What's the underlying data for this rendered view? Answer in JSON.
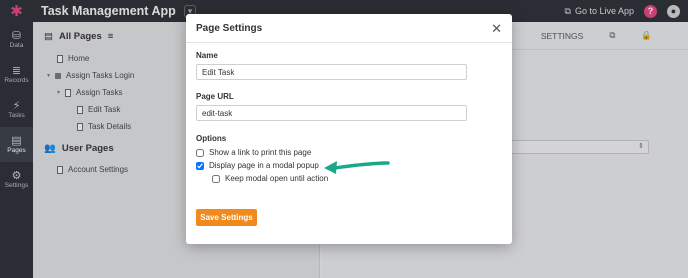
{
  "app": {
    "title": "Task Management App",
    "go_live": "Go to Live App"
  },
  "rail": [
    {
      "label": "Data",
      "icon": "database-icon",
      "glyph": "⛁"
    },
    {
      "label": "Records",
      "icon": "records-icon",
      "glyph": "≡"
    },
    {
      "label": "Tasks",
      "icon": "tasks-icon",
      "glyph": "⚡"
    },
    {
      "label": "Pages",
      "icon": "pages-icon",
      "glyph": "▤"
    },
    {
      "label": "Settings",
      "icon": "gear-icon",
      "glyph": "⚙"
    }
  ],
  "sidebar": {
    "all_pages": "All Pages",
    "tree": [
      {
        "label": "Home",
        "indent": 24,
        "kind": "doc"
      },
      {
        "label": "Assign Tasks Login",
        "indent": 14,
        "kind": "lock",
        "toggle": true
      },
      {
        "label": "Assign Tasks",
        "indent": 24,
        "kind": "doc",
        "toggle": true
      },
      {
        "label": "Edit Task",
        "indent": 44,
        "kind": "doc"
      },
      {
        "label": "Task Details",
        "indent": 44,
        "kind": "doc"
      }
    ],
    "user_pages": "User Pages",
    "user_tree": [
      {
        "label": "Account Settings",
        "indent": 24,
        "kind": "doc"
      }
    ]
  },
  "editor": {
    "settings_tab": "SETTINGS"
  },
  "modal": {
    "title": "Page Settings",
    "name_label": "Name",
    "name_value": "Edit Task",
    "url_label": "Page URL",
    "url_value": "edit-task",
    "options_label": "Options",
    "opt_print": "Show a link to print this page",
    "opt_modal": "Display page in a modal popup",
    "opt_keep_open": "Keep modal open until action",
    "save_label": "Save Settings"
  },
  "colors": {
    "accent_button": "#f08a1c",
    "annotation_arrow": "#1aa88a",
    "logo": "#e0457b"
  }
}
